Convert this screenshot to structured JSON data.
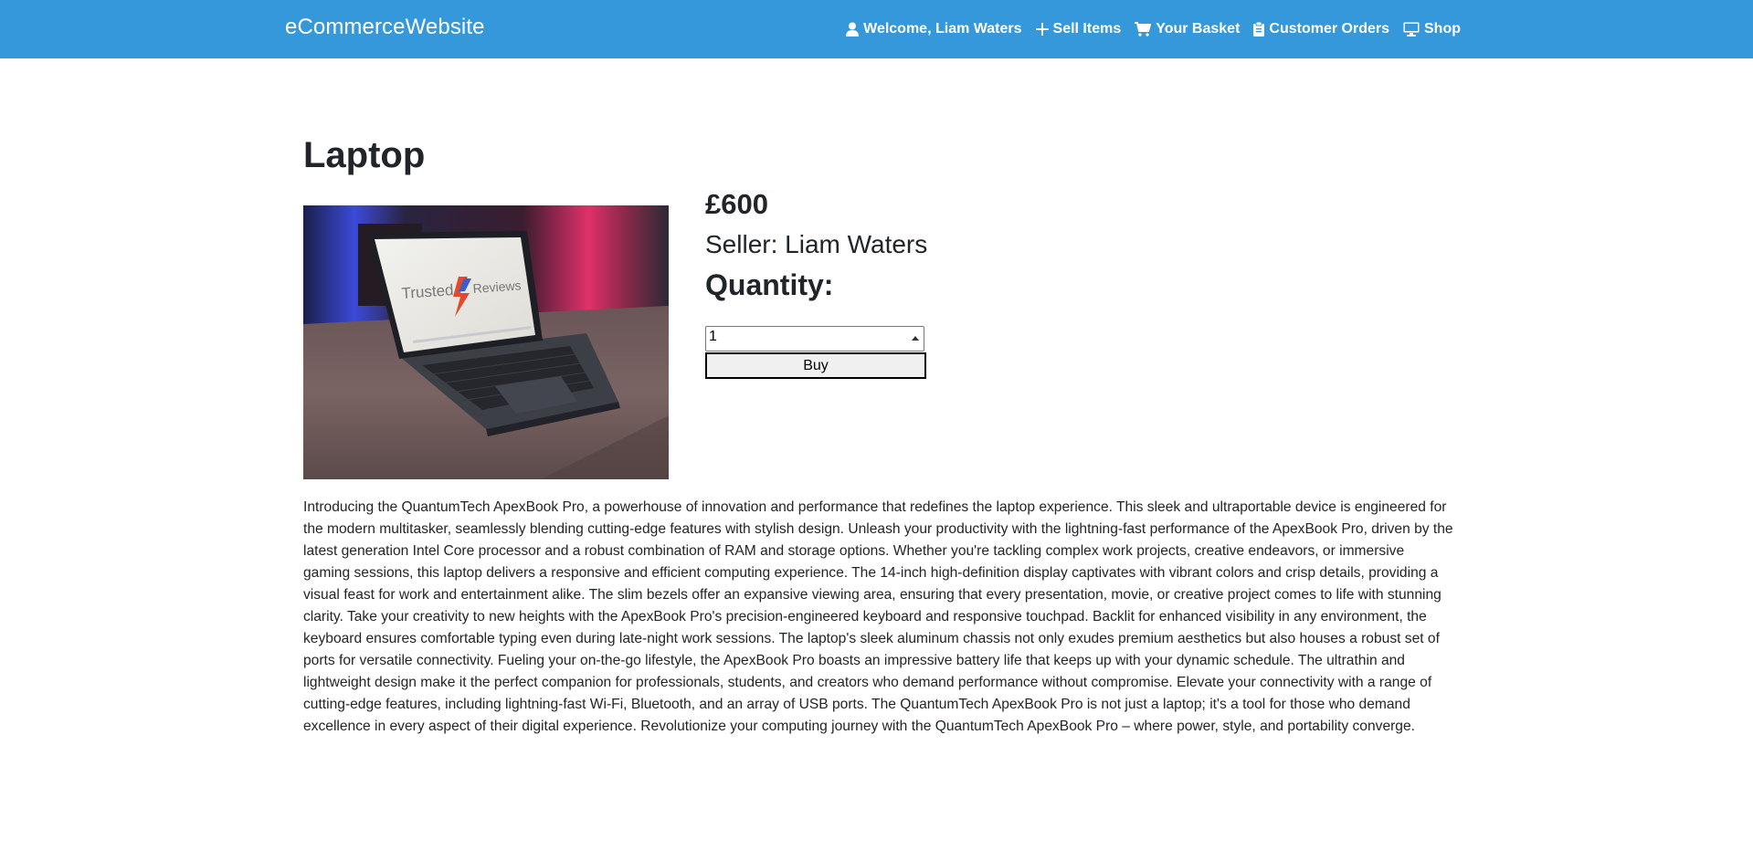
{
  "navbar": {
    "brand": "eCommerceWebsite",
    "links": [
      {
        "label": "Welcome, Liam Waters",
        "icon": "user-icon"
      },
      {
        "label": "Sell Items",
        "icon": "plus-icon"
      },
      {
        "label": "Your Basket",
        "icon": "cart-icon"
      },
      {
        "label": "Customer Orders",
        "icon": "clipboard-icon"
      },
      {
        "label": "Shop",
        "icon": "desktop-icon"
      }
    ],
    "background_color": "#3498db"
  },
  "product": {
    "title": "Laptop",
    "price": "£600",
    "seller": "Seller: Liam Waters",
    "image_screen_text": [
      "Trusted",
      "Reviews"
    ],
    "quantity_label": "Quantity:",
    "quantity_value": "1",
    "buy_label": "Buy",
    "description": "Introducing the QuantumTech ApexBook Pro, a powerhouse of innovation and performance that redefines the laptop experience. This sleek and ultraportable device is engineered for the modern multitasker, seamlessly blending cutting-edge features with stylish design. Unleash your productivity with the lightning-fast performance of the ApexBook Pro, driven by the latest generation Intel Core processor and a robust combination of RAM and storage options. Whether you're tackling complex work projects, creative endeavors, or immersive gaming sessions, this laptop delivers a responsive and efficient computing experience. The 14-inch high-definition display captivates with vibrant colors and crisp details, providing a visual feast for work and entertainment alike. The slim bezels offer an expansive viewing area, ensuring that every presentation, movie, or creative project comes to life with stunning clarity. Take your creativity to new heights with the ApexBook Pro's precision-engineered keyboard and responsive touchpad. Backlit for enhanced visibility in any environment, the keyboard ensures comfortable typing even during late-night work sessions. The laptop's sleek aluminum chassis not only exudes premium aesthetics but also houses a robust set of ports for versatile connectivity. Fueling your on-the-go lifestyle, the ApexBook Pro boasts an impressive battery life that keeps up with your dynamic schedule. The ultrathin and lightweight design make it the perfect companion for professionals, students, and creators who demand performance without compromise. Elevate your connectivity with a range of cutting-edge features, including lightning-fast Wi-Fi, Bluetooth, and an array of USB ports. The QuantumTech ApexBook Pro is not just a laptop; it's a tool for those who demand excellence in every aspect of their digital experience. Revolutionize your computing journey with the QuantumTech ApexBook Pro – where power, style, and portability converge."
  }
}
